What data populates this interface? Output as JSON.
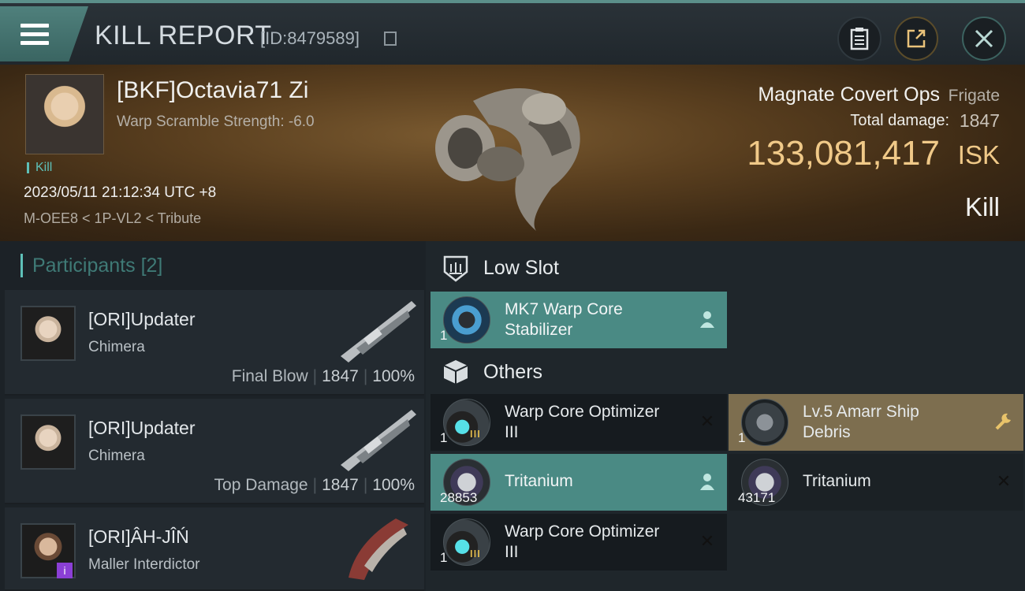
{
  "header": {
    "title": "KILL REPORT",
    "report_id": "[ID:8479589]",
    "icons": [
      "menu-icon",
      "copy-icon",
      "clipboard-icon",
      "share-icon",
      "close-icon"
    ]
  },
  "victim": {
    "name": "[BKF]Octavia71 Zi",
    "sub": "Warp Scramble Strength: -6.0",
    "tag": "Kill",
    "datetime": "2023/05/11 21:12:34 UTC +8",
    "location": "M-OEE8 < 1P-VL2 < Tribute",
    "ship_name": "Magnate Covert Ops",
    "ship_class": "Frigate",
    "total_damage_label": "Total damage:",
    "total_damage": "1847",
    "isk_value": "133,081,417",
    "isk_unit": "ISK",
    "result": "Kill"
  },
  "participants": {
    "label": "Participants",
    "count": "[2]",
    "rows": [
      {
        "name": "[ORI]Updater",
        "ship": "Chimera",
        "stat_label": "Final Blow",
        "damage": "1847",
        "percent": "100%"
      },
      {
        "name": "[ORI]Updater",
        "ship": "Chimera",
        "stat_label": "Top Damage",
        "damage": "1847",
        "percent": "100%"
      },
      {
        "name": "[ORI]ÂH-JÎŃ",
        "ship": "Maller Interdictor",
        "badge": "i"
      }
    ]
  },
  "loot": {
    "low_slot_title": "Low Slot",
    "others_title": "Others",
    "low_slot": [
      {
        "name_line1": "MK7 Warp Core",
        "name_line2": "Stabilizer",
        "qty": "1",
        "state": "teal"
      }
    ],
    "others": [
      {
        "name_line1": "Warp Core Optimizer",
        "name_line2": "III",
        "qty": "1",
        "meta": "III",
        "state": "dark"
      },
      {
        "name_line1": "Lv.5 Amarr Ship",
        "name_line2": "Debris",
        "qty": "1",
        "state": "gold"
      },
      {
        "name_line1": "Tritanium",
        "name_line2": "",
        "qty": "28853",
        "state": "teal"
      },
      {
        "name_line1": "Tritanium",
        "name_line2": "",
        "qty": "43171",
        "state": "dark"
      },
      {
        "name_line1": "Warp Core Optimizer",
        "name_line2": "III",
        "qty": "1",
        "meta": "III",
        "state": "dark"
      }
    ],
    "close_glyph": "✕",
    "wrench_glyph": "🔧"
  },
  "colors": {
    "accent_teal": "#4a8a84",
    "isk_gold": "#f0c988",
    "debris_gold": "#7d6e4f"
  }
}
